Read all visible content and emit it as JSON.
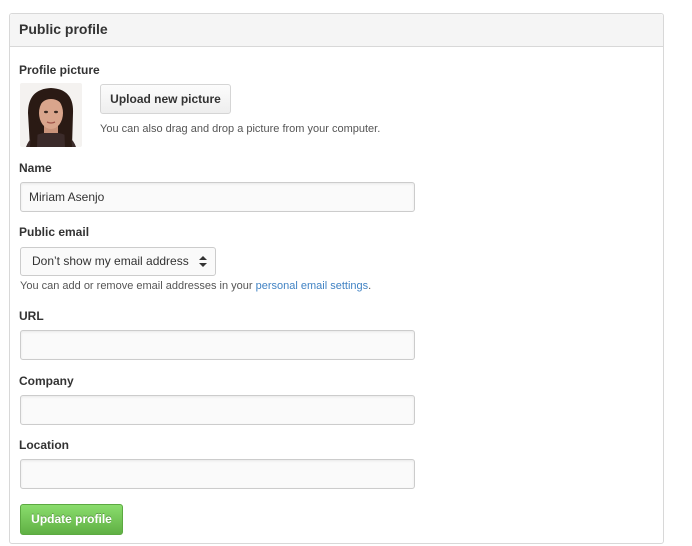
{
  "panel": {
    "title": "Public profile"
  },
  "profile_picture": {
    "label": "Profile picture",
    "upload_button": "Upload new picture",
    "hint": "You can also drag and drop a picture from your computer."
  },
  "name": {
    "label": "Name",
    "value": "Miriam Asenjo"
  },
  "public_email": {
    "label": "Public email",
    "selected": "Don’t show my email address",
    "hint_prefix": "You can add or remove email addresses in your ",
    "hint_link": "personal email settings",
    "hint_suffix": "."
  },
  "url": {
    "label": "URL",
    "value": ""
  },
  "company": {
    "label": "Company",
    "value": ""
  },
  "location": {
    "label": "Location",
    "value": ""
  },
  "actions": {
    "update_button": "Update profile"
  },
  "colors": {
    "link": "#4183c4",
    "primary_button": "#6cc644",
    "panel_header_bg": "#f5f5f5"
  }
}
